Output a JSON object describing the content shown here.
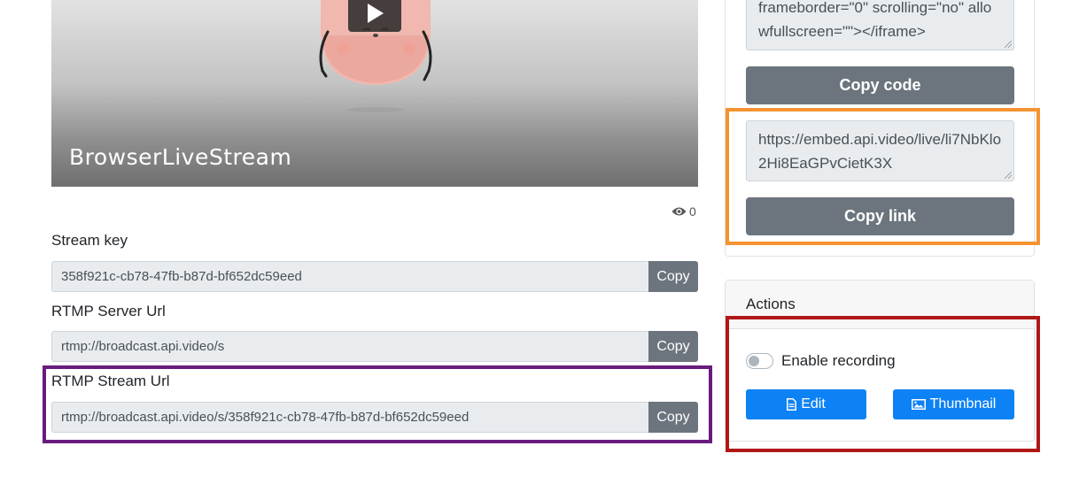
{
  "video": {
    "title": "BrowserLiveStream",
    "viewers": "0"
  },
  "stream_key": {
    "label": "Stream key",
    "value": "358f921c-cb78-47fb-b87d-bf652dc59eed",
    "copy_label": "Copy"
  },
  "rtmp_server": {
    "label": "RTMP Server Url",
    "value": "rtmp://broadcast.api.video/s",
    "copy_label": "Copy"
  },
  "rtmp_stream": {
    "label": "RTMP Stream Url",
    "value": "rtmp://broadcast.api.video/s/358f921c-cb78-47fb-b87d-bf652dc59eed",
    "copy_label": "Copy"
  },
  "embed": {
    "code_text": "frameborder=\"0\" scrolling=\"no\" allowfullscreen=\"\"></iframe>",
    "copy_code_label": "Copy code",
    "link_text": "https://embed.api.video/live/li7NbKlo2Hi8EaGPvCietK3X",
    "copy_link_label": "Copy link"
  },
  "actions": {
    "header": "Actions",
    "recording_label": "Enable recording",
    "recording_enabled": false,
    "edit_label": "Edit",
    "thumbnail_label": "Thumbnail"
  },
  "colors": {
    "primary": "#0d82f5",
    "secondary": "#6c757d",
    "highlight_purple": "#6a1b7e",
    "highlight_orange": "#f59331",
    "highlight_red": "#b01818"
  }
}
